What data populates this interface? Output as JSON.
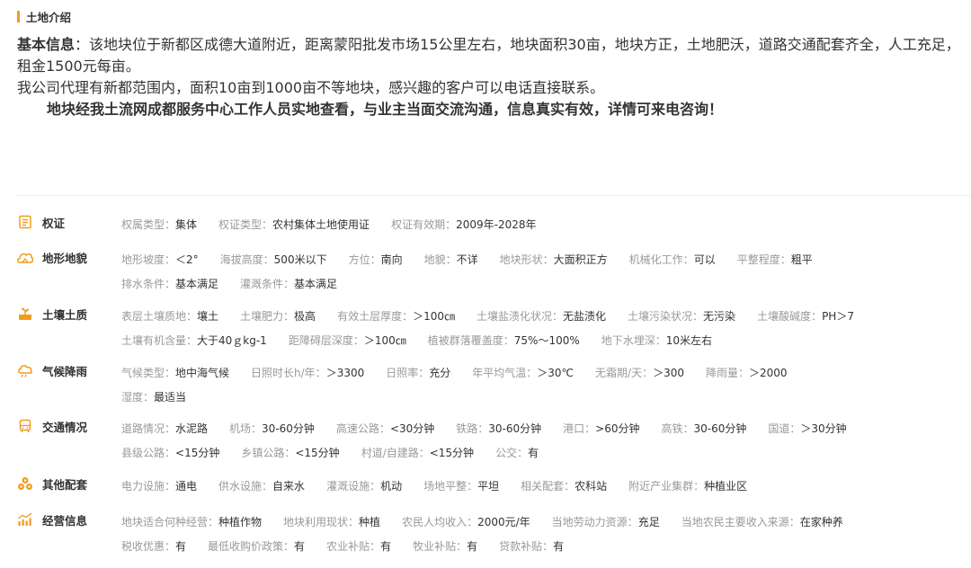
{
  "section_title": "土地介绍",
  "intro": {
    "label": "基本信息",
    "text1": "：该地块位于新都区成德大道附近，距离蒙阳批发市场15公里左右，地块面积30亩，地块方正，土地肥沃，道路交通配套齐全，人工充足，租金1500元每亩。",
    "text2": "我公司代理有新都范围内，面积10亩到1000亩不等地块，感兴趣的客户可以电话直接联系。",
    "text3": "地块经我土流网成都服务中心工作人员实地查看，与业主当面交流沟通，信息真实有效，详情可来电咨询！"
  },
  "accent_color": "#f29b1d",
  "rows": [
    {
      "name": "权证",
      "icon": "certificate-icon",
      "lines": [
        [
          {
            "k": "权属类型：",
            "v": "集体"
          },
          {
            "k": "权证类型：",
            "v": "农村集体土地使用证"
          },
          {
            "k": "权证有效期：",
            "v": "2009年-2028年"
          }
        ]
      ]
    },
    {
      "name": "地形地貌",
      "icon": "terrain-icon",
      "lines": [
        [
          {
            "k": "地形坡度：",
            "v": "＜2°"
          },
          {
            "k": "海拔高度：",
            "v": "500米以下"
          },
          {
            "k": "方位：",
            "v": "南向"
          },
          {
            "k": "地貌：",
            "v": "不详"
          },
          {
            "k": "地块形状：",
            "v": "大面积正方"
          },
          {
            "k": "机械化工作：",
            "v": "可以"
          },
          {
            "k": "平整程度：",
            "v": "粗平"
          }
        ],
        [
          {
            "k": "排水条件：",
            "v": "基本满足"
          },
          {
            "k": "灌溉条件：",
            "v": "基本满足"
          }
        ]
      ]
    },
    {
      "name": "土壤土质",
      "icon": "soil-icon",
      "lines": [
        [
          {
            "k": "表层土壤质地：",
            "v": "壤土"
          },
          {
            "k": "土壤肥力：",
            "v": "极高"
          },
          {
            "k": "有效土层厚度：",
            "v": "＞100㎝"
          },
          {
            "k": "土壤盐渍化状况：",
            "v": "无盐渍化"
          },
          {
            "k": "土壤污染状况：",
            "v": "无污染"
          },
          {
            "k": "土壤酸碱度：",
            "v": "PH＞7"
          }
        ],
        [
          {
            "k": "土壤有机含量：",
            "v": "大于40ｇkg-1"
          },
          {
            "k": "距障碍层深度：",
            "v": "＞100㎝"
          },
          {
            "k": "植被群落覆盖度：",
            "v": "75%～100%"
          },
          {
            "k": "地下水埋深：",
            "v": "10米左右"
          }
        ]
      ]
    },
    {
      "name": "气候降雨",
      "icon": "cloud-rain-icon",
      "lines": [
        [
          {
            "k": "气候类型：",
            "v": "地中海气候"
          },
          {
            "k": "日照时长h/年：",
            "v": "＞3300"
          },
          {
            "k": "日照率：",
            "v": "充分"
          },
          {
            "k": "年平均气温：",
            "v": "＞30℃"
          },
          {
            "k": "无霜期/天：",
            "v": "＞300"
          },
          {
            "k": "降雨量：",
            "v": "＞2000"
          }
        ],
        [
          {
            "k": "湿度：",
            "v": "最适当"
          }
        ]
      ]
    },
    {
      "name": "交通情况",
      "icon": "bus-icon",
      "lines": [
        [
          {
            "k": "道路情况：",
            "v": "水泥路"
          },
          {
            "k": "机场：",
            "v": "30-60分钟"
          },
          {
            "k": "高速公路：",
            "v": "<30分钟"
          },
          {
            "k": "铁路：",
            "v": "30-60分钟"
          },
          {
            "k": "港口：",
            "v": ">60分钟"
          },
          {
            "k": "高铁：",
            "v": "30-60分钟"
          },
          {
            "k": "国道：",
            "v": "＞30分钟"
          }
        ],
        [
          {
            "k": "县级公路：",
            "v": "<15分钟"
          },
          {
            "k": "乡镇公路：",
            "v": "<15分钟"
          },
          {
            "k": "村道/自建路：",
            "v": "<15分钟"
          },
          {
            "k": "公交：",
            "v": "有"
          }
        ]
      ]
    },
    {
      "name": "其他配套",
      "icon": "facilities-icon",
      "lines": [
        [
          {
            "k": "电力设施：",
            "v": "通电"
          },
          {
            "k": "供水设施：",
            "v": "自来水"
          },
          {
            "k": "灌溉设施：",
            "v": "机动"
          },
          {
            "k": "场地平整：",
            "v": "平坦"
          },
          {
            "k": "相关配套：",
            "v": "农科站"
          },
          {
            "k": "附近产业集群：",
            "v": "种植业区"
          }
        ]
      ]
    },
    {
      "name": "经营信息",
      "icon": "chart-icon",
      "lines": [
        [
          {
            "k": "地块适合何种经营：",
            "v": "种植作物"
          },
          {
            "k": "地块利用现状：",
            "v": "种植"
          },
          {
            "k": "农民人均收入：",
            "v": "2000元/年"
          },
          {
            "k": "当地劳动力资源：",
            "v": "充足"
          },
          {
            "k": "当地农民主要收入来源：",
            "v": "在家种养"
          }
        ],
        [
          {
            "k": "税收优惠：",
            "v": "有"
          },
          {
            "k": "最低收购价政策：",
            "v": "有"
          },
          {
            "k": "农业补贴：",
            "v": "有"
          },
          {
            "k": "牧业补贴：",
            "v": "有"
          },
          {
            "k": "贷款补贴：",
            "v": "有"
          }
        ]
      ]
    }
  ]
}
